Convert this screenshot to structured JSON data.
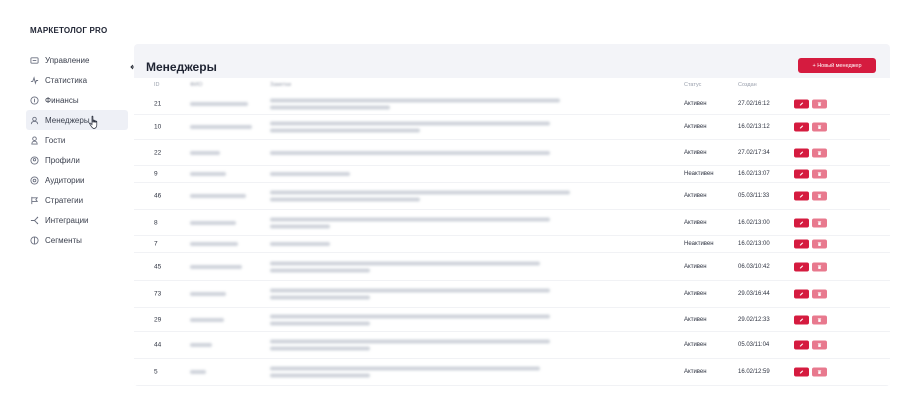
{
  "brand": "МАРКЕТОЛОГ PRO",
  "sidebar": {
    "items": [
      {
        "label": "Управление",
        "icon": "dashboard-icon"
      },
      {
        "label": "Статистика",
        "icon": "activity-icon"
      },
      {
        "label": "Финансы",
        "icon": "coin-icon"
      },
      {
        "label": "Менеджеры",
        "icon": "user-icon",
        "active": true
      },
      {
        "label": "Гости",
        "icon": "guest-icon"
      },
      {
        "label": "Профили",
        "icon": "profile-icon"
      },
      {
        "label": "Аудитории",
        "icon": "audience-icon"
      },
      {
        "label": "Стратегии",
        "icon": "strategy-icon"
      },
      {
        "label": "Интеграции",
        "icon": "integration-icon"
      },
      {
        "label": "Сегменты",
        "icon": "segment-icon"
      }
    ]
  },
  "main": {
    "title": "Менеджеры",
    "new_button": "+ Новый менеджер",
    "headers": {
      "status": "Статус",
      "created": "Создан"
    },
    "rows": [
      {
        "id": "21",
        "status": "Активен",
        "date": "27.02/16:12",
        "lines": 2
      },
      {
        "id": "10",
        "status": "Активен",
        "date": "16.02/13:12",
        "lines": 2
      },
      {
        "id": "22",
        "status": "Активен",
        "date": "27.02/17:34",
        "lines": 2
      },
      {
        "id": "9",
        "status": "Неактивен",
        "date": "16.02/13:07",
        "lines": 1
      },
      {
        "id": "46",
        "status": "Активен",
        "date": "05.03/11:33",
        "lines": 2
      },
      {
        "id": "8",
        "status": "Активен",
        "date": "16.02/13:00",
        "lines": 2
      },
      {
        "id": "7",
        "status": "Неактивен",
        "date": "16.02/13:00",
        "lines": 1
      },
      {
        "id": "45",
        "status": "Активен",
        "date": "06.03/10:42",
        "lines": 2
      },
      {
        "id": "73",
        "status": "Активен",
        "date": "29.03/16:44",
        "lines": 2
      },
      {
        "id": "29",
        "status": "Активен",
        "date": "29.02/12:33",
        "lines": 2
      },
      {
        "id": "44",
        "status": "Активен",
        "date": "05.03/11:04",
        "lines": 2
      },
      {
        "id": "5",
        "status": "Активен",
        "date": "16.02/12:59",
        "lines": 2
      }
    ]
  }
}
